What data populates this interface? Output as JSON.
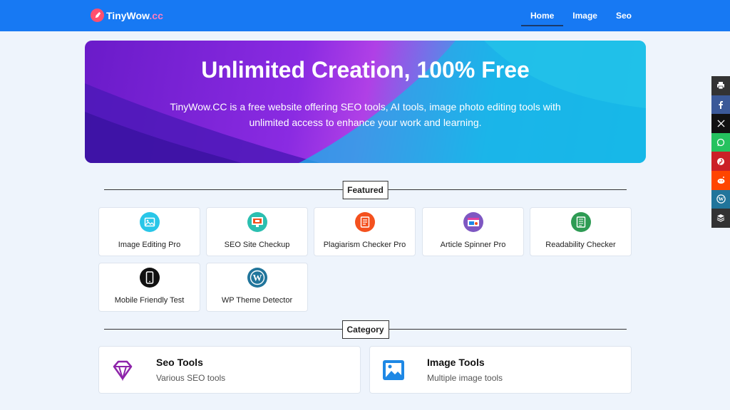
{
  "header": {
    "logo_name": "TinyWow",
    "logo_tld": ".cc",
    "nav": [
      {
        "label": "Home",
        "active": true
      },
      {
        "label": "Image",
        "active": false
      },
      {
        "label": "Seo",
        "active": false
      }
    ]
  },
  "hero": {
    "title": "Unlimited Creation, 100% Free",
    "subtitle": "TinyWow.CC is a free website offering SEO tools, AI tools, image photo editing tools with unlimited access to enhance your work and learning."
  },
  "featured": {
    "heading": "Featured",
    "items": [
      {
        "label": "Image Editing Pro",
        "icon": "image-icon",
        "color": "#29c6e8"
      },
      {
        "label": "SEO Site Checkup",
        "icon": "seo-monitor-icon",
        "color": "#2bbfb0"
      },
      {
        "label": "Plagiarism Checker Pro",
        "icon": "document-check-icon",
        "color": "#f4511e"
      },
      {
        "label": "Article Spinner Pro",
        "icon": "browser-window-icon",
        "color": "#7e57c2"
      },
      {
        "label": "Readability Checker",
        "icon": "document-text-icon",
        "color": "#2e9b54"
      },
      {
        "label": "Mobile Friendly Test",
        "icon": "mobile-phone-icon",
        "color": "#111111"
      },
      {
        "label": "WP Theme Detector",
        "icon": "wordpress-icon",
        "color": "#21759b"
      }
    ]
  },
  "category": {
    "heading": "Category",
    "items": [
      {
        "title": "Seo Tools",
        "subtitle": "Various SEO tools",
        "icon": "diamond-icon",
        "color": "#8e24aa"
      },
      {
        "title": "Image Tools",
        "subtitle": "Multiple image tools",
        "icon": "image-icon",
        "color": "#1e88e5"
      }
    ]
  },
  "share": [
    {
      "icon": "print-icon",
      "color": "#333333"
    },
    {
      "icon": "facebook-icon",
      "color": "#3b5998"
    },
    {
      "icon": "x-twitter-icon",
      "color": "#111111"
    },
    {
      "icon": "whatsapp-icon",
      "color": "#25c25f"
    },
    {
      "icon": "pinterest-icon",
      "color": "#cb2027"
    },
    {
      "icon": "reddit-icon",
      "color": "#ff4500"
    },
    {
      "icon": "wordpress-icon",
      "color": "#21759b"
    },
    {
      "icon": "buffer-icon",
      "color": "#333333"
    }
  ]
}
